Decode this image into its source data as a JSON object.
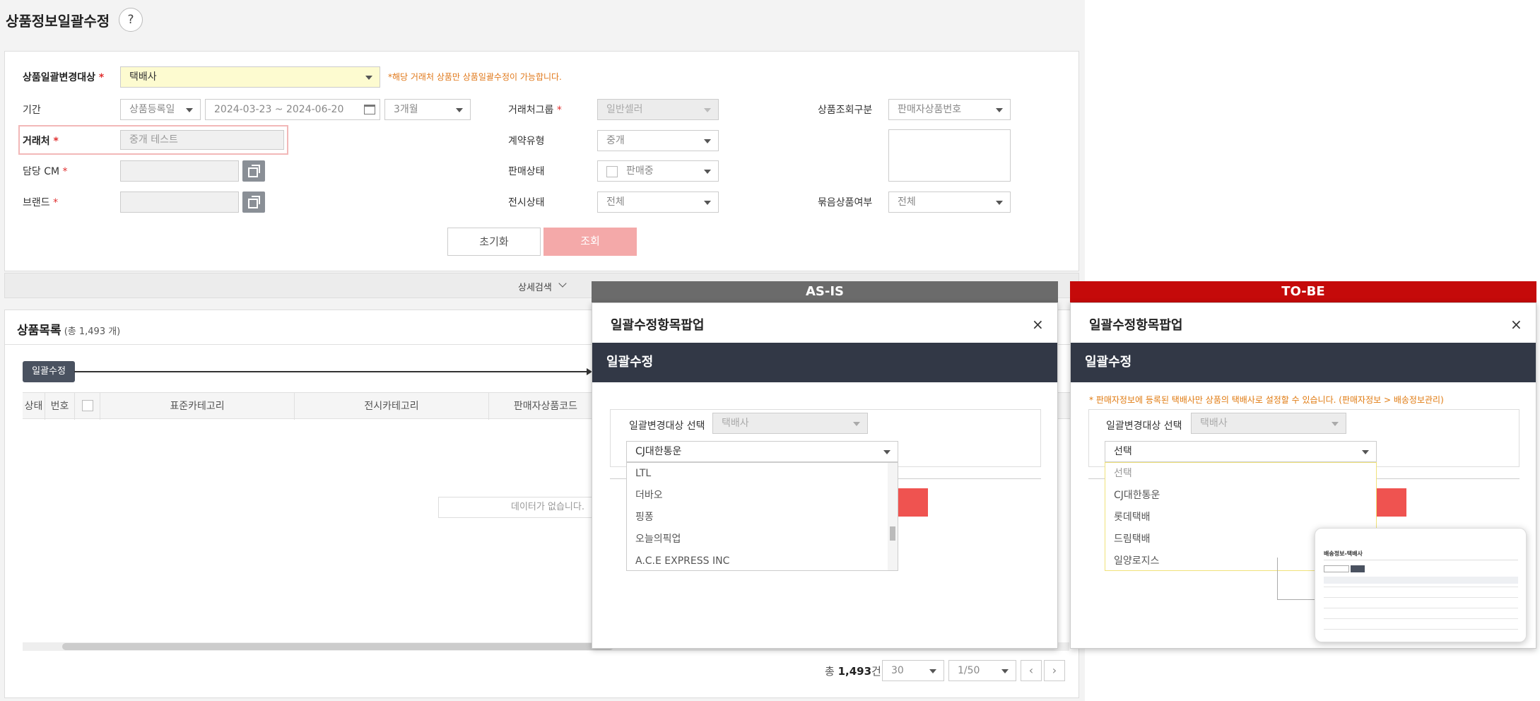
{
  "page": {
    "title": "상품정보일괄수정",
    "help_label": "?"
  },
  "search": {
    "target_label": "상품일괄변경대상",
    "req_mark": "*",
    "target_value": "택배사",
    "target_notice": "*해당 거래처 상품만 상품일괄수정이 가능합니다.",
    "period_label": "기간",
    "period_type": "상품등록일",
    "date_range": "2024-03-23 ~ 2024-06-20",
    "period_months": "3개월",
    "partner_label": "거래처",
    "partner_value": "중개 테스트",
    "cm_label": "담당 CM",
    "brand_label": "브랜드",
    "partner_group_label": "거래처그룹",
    "partner_group_value": "일반셀러",
    "contract_label": "계약유형",
    "contract_value": "중개",
    "sale_status_label": "판매상태",
    "sale_status_value": "판매중",
    "display_status_label": "전시상태",
    "display_status_value": "전체",
    "query_type_label": "상품조회구분",
    "query_type_value": "판매자상품번호",
    "bundle_label": "묶음상품여부",
    "bundle_value": "전체",
    "reset_button": "초기화",
    "search_button": "조회",
    "detail_search": "상세검색"
  },
  "list": {
    "title": "상품목록",
    "count_text": "(총 1,493 개)",
    "bulk_button": "일괄수정",
    "columns": [
      "상태",
      "번호",
      "표준카테고리",
      "전시카테고리",
      "판매자상품코드"
    ],
    "empty_text": "데이터가 없습니다.",
    "total_label": "총",
    "total_value": "1,493",
    "total_unit": "건",
    "page_size": "30",
    "page_info": "1/50"
  },
  "asis": {
    "banner": "AS-IS",
    "popup_title": "일괄수정항목팝업",
    "section": "일괄수정",
    "target_label": "일괄변경대상 선택",
    "target_value": "택배사",
    "carrier_value": "CJ대한통운",
    "options": [
      "LTL",
      "더바오",
      "핑퐁",
      "오늘의픽업",
      "A.C.E EXPRESS INC"
    ]
  },
  "tobe": {
    "banner": "TO-BE",
    "popup_title": "일괄수정항목팝업",
    "section": "일괄수정",
    "notice": "* 판매자정보에 등록된 택배사만 상품의 택배사로 설정할 수 있습니다. (판매자정보 > 배송정보관리)",
    "target_label": "일괄변경대상 선택",
    "target_value": "택배사",
    "carrier_value": "선택",
    "options": [
      "선택",
      "CJ대한통운",
      "롯데택배",
      "드림택배",
      "일양로지스"
    ],
    "thumb_title": "배송정보-택배사"
  },
  "colors": {
    "asis_banner": "#6b6b6b",
    "tobe_banner": "#c50a0a",
    "primary_disabled": "#f4a9a9",
    "popup_dark": "#323846",
    "confirm_red": "#ef5350"
  }
}
